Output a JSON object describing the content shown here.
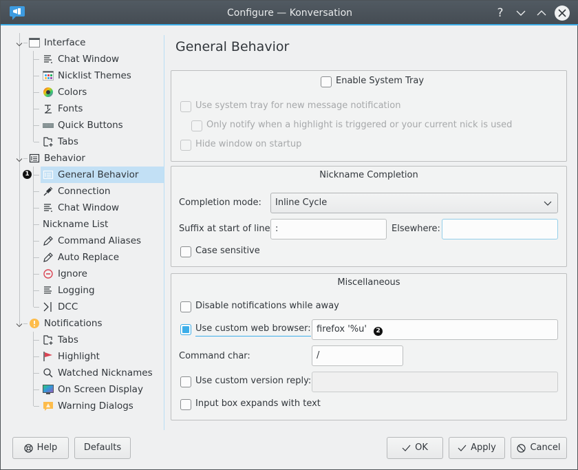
{
  "window": {
    "title": "Configure — Konversation",
    "app_icon": "konversation-app-icon",
    "controls": [
      {
        "name": "help",
        "glyph": "?"
      },
      {
        "name": "minimize",
        "glyph": "⌄"
      },
      {
        "name": "maximize",
        "glyph": "⌃"
      },
      {
        "name": "close",
        "glyph": "✕"
      }
    ]
  },
  "sidebar": {
    "groups": [
      {
        "label": "Interface",
        "icon": "window-icon",
        "expanded": true,
        "items": [
          {
            "label": "Chat Window",
            "icon": "text-lines-icon"
          },
          {
            "label": "Nicklist Themes",
            "icon": "nicklist-theme-icon"
          },
          {
            "label": "Colors",
            "icon": "color-wheel-icon"
          },
          {
            "label": "Fonts",
            "icon": "font-icon"
          },
          {
            "label": "Quick Buttons",
            "icon": "keyboard-icon"
          },
          {
            "label": "Tabs",
            "icon": "new-tab-icon"
          }
        ]
      },
      {
        "label": "Behavior",
        "icon": "form-icon",
        "expanded": true,
        "items": [
          {
            "label": "General Behavior",
            "icon": "form-icon",
            "selected": true,
            "marker": "1"
          },
          {
            "label": "Connection",
            "icon": "plug-icon"
          },
          {
            "label": "Chat Window",
            "icon": "text-lines-icon"
          },
          {
            "label": "Nickname List",
            "icon": ""
          },
          {
            "label": "Command Aliases",
            "icon": "pencil-icon"
          },
          {
            "label": "Auto Replace",
            "icon": "pencil-icon"
          },
          {
            "label": "Ignore",
            "icon": "block-icon"
          },
          {
            "label": "Logging",
            "icon": "log-lines-icon"
          },
          {
            "label": "DCC",
            "icon": "terminal-icon"
          }
        ]
      },
      {
        "label": "Notifications",
        "icon": "warning-circle-icon",
        "expanded": true,
        "items": [
          {
            "label": "Tabs",
            "icon": "new-tab-icon"
          },
          {
            "label": "Highlight",
            "icon": "flag-icon"
          },
          {
            "label": "Watched Nicknames",
            "icon": "search-icon"
          },
          {
            "label": "On Screen Display",
            "icon": "monitor-icon"
          },
          {
            "label": "Warning Dialogs",
            "icon": "warning-dialog-icon"
          }
        ]
      }
    ]
  },
  "main": {
    "page_title": "General Behavior",
    "system_tray": {
      "enable_label": "Enable System Tray",
      "enable_checked": false,
      "options": [
        {
          "label": "Use system tray for new message notification",
          "checked": false,
          "enabled": false
        },
        {
          "label": "Only notify when a highlight is triggered or your current nick is used",
          "checked": false,
          "enabled": false
        },
        {
          "label": "Hide window on startup",
          "checked": false,
          "enabled": false
        }
      ]
    },
    "nickname_completion": {
      "title": "Nickname Completion",
      "mode_label": "Completion mode:",
      "mode_value": "Inline Cycle",
      "suffix_label": "Suffix at start of line:",
      "suffix_value": ":",
      "elsewhere_label": "Elsewhere:",
      "elsewhere_value": "",
      "case_sensitive_label": "Case sensitive",
      "case_sensitive_checked": false
    },
    "misc": {
      "title": "Miscellaneous",
      "disable_notifications_label": "Disable notifications while away",
      "disable_notifications_checked": false,
      "custom_browser_label": "Use custom web browser:",
      "custom_browser_checked": true,
      "custom_browser_value": "firefox '%u'",
      "custom_browser_marker": "2",
      "command_char_label": "Command char:",
      "command_char_value": "/",
      "custom_version_label": "Use custom version reply:",
      "custom_version_checked": false,
      "custom_version_value": "",
      "input_expands_label": "Input box expands with text",
      "input_expands_checked": false
    }
  },
  "buttons": {
    "help": "Help",
    "defaults": "Defaults",
    "ok": "OK",
    "apply": "Apply",
    "cancel": "Cancel"
  },
  "colors": {
    "accent": "#3daee9",
    "selection": "#c2e0f5",
    "titlebar": "#4b535a"
  }
}
